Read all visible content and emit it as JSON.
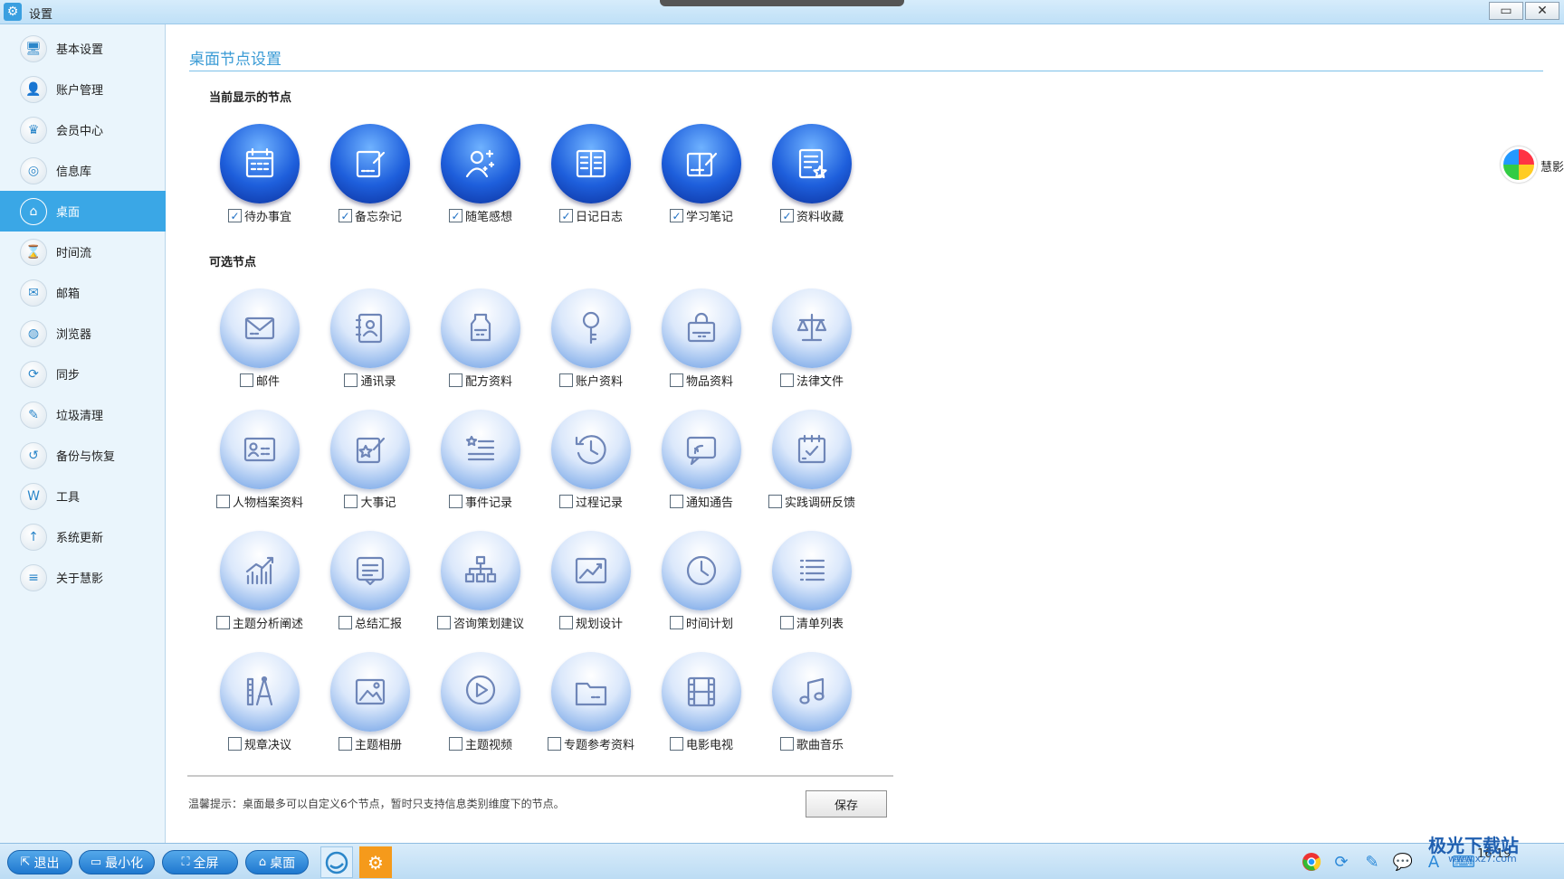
{
  "window": {
    "title": "设置",
    "minimize_glyph": "▭",
    "close_glyph": "✕"
  },
  "sidebar": {
    "items": [
      {
        "label": "基本设置",
        "icon": "monitor-icon",
        "glyph": "🖥"
      },
      {
        "label": "账户管理",
        "icon": "user-icon",
        "glyph": "👤"
      },
      {
        "label": "会员中心",
        "icon": "crown-icon",
        "glyph": "♛"
      },
      {
        "label": "信息库",
        "icon": "database-icon",
        "glyph": "◎"
      },
      {
        "label": "桌面",
        "icon": "home-icon",
        "glyph": "⌂",
        "active": true
      },
      {
        "label": "时间流",
        "icon": "hourglass-icon",
        "glyph": "⌛"
      },
      {
        "label": "邮箱",
        "icon": "mailbox-icon",
        "glyph": "✉"
      },
      {
        "label": "浏览器",
        "icon": "globe-icon",
        "glyph": "◍"
      },
      {
        "label": "同步",
        "icon": "sync-icon",
        "glyph": "⟳"
      },
      {
        "label": "垃圾清理",
        "icon": "broom-icon",
        "glyph": "✎"
      },
      {
        "label": "备份与恢复",
        "icon": "backup-icon",
        "glyph": "↺"
      },
      {
        "label": "工具",
        "icon": "tools-icon",
        "glyph": "W"
      },
      {
        "label": "系统更新",
        "icon": "arrow-up-icon",
        "glyph": "↑"
      },
      {
        "label": "关于慧影",
        "icon": "list-icon",
        "glyph": "≡"
      }
    ]
  },
  "main": {
    "title": "桌面节点设置",
    "current_label": "当前显示的节点",
    "optional_label": "可选节点",
    "current_nodes": [
      {
        "label": "待办事宜",
        "icon": "calendar-icon",
        "checked": true
      },
      {
        "label": "备忘杂记",
        "icon": "notepad-icon",
        "checked": true
      },
      {
        "label": "随笔感想",
        "icon": "thoughts-icon",
        "checked": true
      },
      {
        "label": "日记日志",
        "icon": "diary-icon",
        "checked": true
      },
      {
        "label": "学习笔记",
        "icon": "study-notes-icon",
        "checked": true
      },
      {
        "label": "资料收藏",
        "icon": "favorites-icon",
        "checked": true
      }
    ],
    "optional_nodes": [
      {
        "label": "邮件",
        "icon": "envelope-icon",
        "checked": false
      },
      {
        "label": "通讯录",
        "icon": "contacts-icon",
        "checked": false
      },
      {
        "label": "配方资料",
        "icon": "jar-icon",
        "checked": false
      },
      {
        "label": "账户资料",
        "icon": "key-icon",
        "checked": false
      },
      {
        "label": "物品资料",
        "icon": "bag-icon",
        "checked": false
      },
      {
        "label": "法律文件",
        "icon": "scales-icon",
        "checked": false
      },
      {
        "label": "人物档案资料",
        "icon": "id-card-icon",
        "checked": false
      },
      {
        "label": "大事记",
        "icon": "star-note-icon",
        "checked": false
      },
      {
        "label": "事件记录",
        "icon": "star-list-icon",
        "checked": false
      },
      {
        "label": "过程记录",
        "icon": "clock-history-icon",
        "checked": false
      },
      {
        "label": "通知通告",
        "icon": "announcement-icon",
        "checked": false
      },
      {
        "label": "实践调研反馈",
        "icon": "checklist-icon",
        "checked": false
      },
      {
        "label": "主题分析阐述",
        "icon": "bar-chart-icon",
        "checked": false
      },
      {
        "label": "总结汇报",
        "icon": "report-icon",
        "checked": false
      },
      {
        "label": "咨询策划建议",
        "icon": "org-chart-icon",
        "checked": false
      },
      {
        "label": "规划设计",
        "icon": "picture-trend-icon",
        "checked": false
      },
      {
        "label": "时间计划",
        "icon": "clock-icon",
        "checked": false
      },
      {
        "label": "清单列表",
        "icon": "list-lines-icon",
        "checked": false
      },
      {
        "label": "规章决议",
        "icon": "compass-ruler-icon",
        "checked": false
      },
      {
        "label": "主题相册",
        "icon": "photo-icon",
        "checked": false
      },
      {
        "label": "主题视频",
        "icon": "play-icon",
        "checked": false
      },
      {
        "label": "专题参考资料",
        "icon": "folder-icon",
        "checked": false
      },
      {
        "label": "电影电视",
        "icon": "film-icon",
        "checked": false
      },
      {
        "label": "歌曲音乐",
        "icon": "music-note-icon",
        "checked": false
      }
    ],
    "tip": "温馨提示：桌面最多可以自定义6个节点，暂时只支持信息类别维度下的节点。",
    "save_label": "保存",
    "side_widget_text": "慧影"
  },
  "taskbar": {
    "buttons": [
      {
        "label": "退出",
        "icon": "exit-icon",
        "glyph": "⇱"
      },
      {
        "label": "最小化",
        "icon": "minimize-icon",
        "glyph": "▭"
      },
      {
        "label": "全屏",
        "icon": "fullscreen-icon",
        "glyph": "⛶"
      },
      {
        "label": "桌面",
        "icon": "home-icon",
        "glyph": "⌂"
      }
    ],
    "clock": "16:19",
    "watermark": "极光下载站",
    "watermark_sub": "www.xz7.com"
  },
  "colors": {
    "accent": "#3aa7e6",
    "title_blue": "#3a9bd5",
    "node_on": "#1e5fdc",
    "node_off": "#8fb6ec"
  }
}
